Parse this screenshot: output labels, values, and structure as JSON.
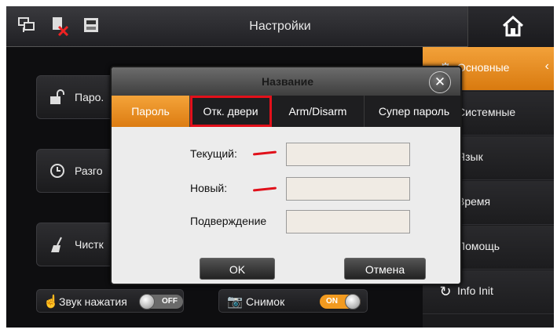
{
  "header": {
    "title": "Настройки",
    "icons": [
      "network-icon",
      "disconnected-icon",
      "sd-card-icon"
    ],
    "home_icon": "home-icon"
  },
  "tiles": [
    {
      "label": "Паро.",
      "icon": "padlock-icon"
    },
    {
      "label": "Разго",
      "icon": "clock-icon"
    },
    {
      "label": "Чистк",
      "icon": "broom-icon"
    }
  ],
  "toggles": {
    "key_sound": {
      "label": "Звук нажатия",
      "state": "OFF"
    },
    "snapshot": {
      "label": "Снимок",
      "state": "ON"
    }
  },
  "right_menu": [
    {
      "label": "Основные",
      "active": true
    },
    {
      "label": "Системные",
      "active": false
    },
    {
      "label": "Язык",
      "active": false
    },
    {
      "label": "Время",
      "active": false
    },
    {
      "label": "Помощь",
      "active": false
    },
    {
      "label": "Info Init",
      "active": false
    }
  ],
  "dialog": {
    "title": "Название",
    "close_icon": "close-icon",
    "tabs": [
      {
        "label": "Пароль",
        "active": true
      },
      {
        "label": "Отк. двери",
        "highlighted": true
      },
      {
        "label": "Arm/Disarm"
      },
      {
        "label": "Супер пароль"
      }
    ],
    "fields": [
      {
        "label": "Текущий:",
        "value": ""
      },
      {
        "label": "Новый:",
        "value": ""
      },
      {
        "label": "Подверждение",
        "value": ""
      }
    ],
    "ok_label": "OK",
    "cancel_label": "Отмена"
  },
  "colors": {
    "accent": "#e88c1f",
    "highlight_box": "#e3101a",
    "background": "#0e0e10"
  }
}
